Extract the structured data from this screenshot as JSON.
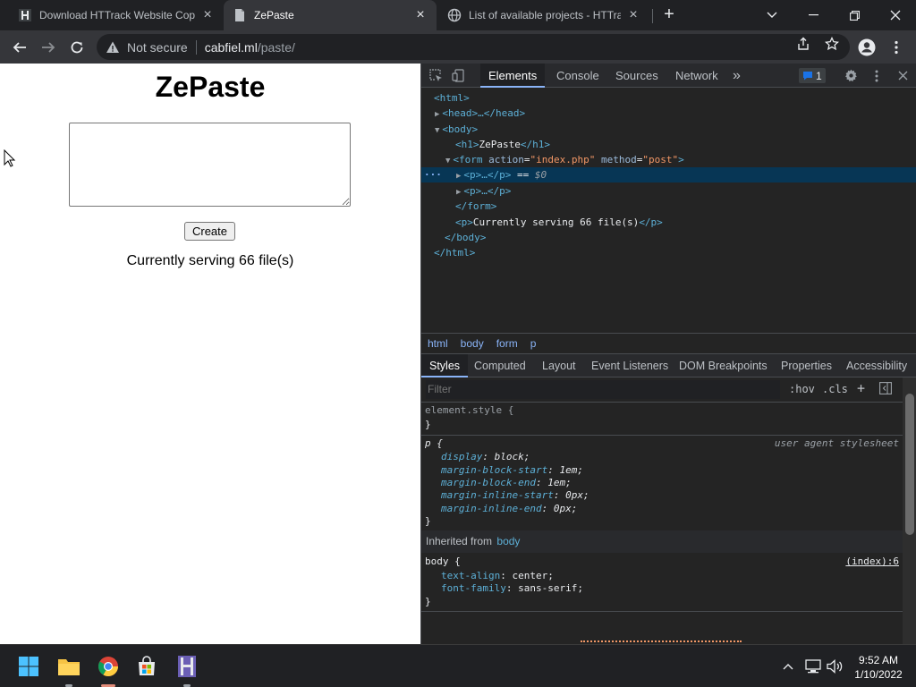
{
  "tabs": [
    {
      "title": "Download HTTrack Website Copier",
      "favicon": "httrack-icon"
    },
    {
      "title": "ZePaste",
      "favicon": "page-icon",
      "active": true
    },
    {
      "title": "List of available projects - HTTrack",
      "favicon": "globe-icon"
    }
  ],
  "omnibox": {
    "security_label": "Not secure",
    "url_host": "cabfiel.ml",
    "url_path": "/paste/"
  },
  "page": {
    "heading": "ZePaste",
    "textarea_value": "",
    "create_label": "Create",
    "serving_text": "Currently serving 66 file(s)"
  },
  "devtools": {
    "tabs": [
      "Elements",
      "Console",
      "Sources",
      "Network"
    ],
    "more": "»",
    "badge_count": "1",
    "dom": {
      "html_open": "<html>",
      "head": "<head>…</head>",
      "body_open": "<body>",
      "h1_open": "<h1>",
      "h1_text": "ZePaste",
      "h1_close": "</h1>",
      "form_tag": "<form",
      "form_action_attr": "action",
      "form_action_val": "\"index.php\"",
      "form_method_attr": "method",
      "form_method_val": "\"post\"",
      "form_gt": ">",
      "p1": "<p>…</p>",
      "p1_eq": "==",
      "p1_dollar": "$0",
      "p2": "<p>…</p>",
      "form_close": "</form>",
      "p3_open": "<p>",
      "p3_text": "Currently serving 66 file(s)",
      "p3_close": "</p>",
      "body_close": "</body>",
      "html_close": "</html>"
    },
    "breadcrumbs": [
      "html",
      "body",
      "form",
      "p"
    ],
    "subtabs": [
      "Styles",
      "Computed",
      "Layout",
      "Event Listeners",
      "DOM Breakpoints",
      "Properties",
      "Accessibility"
    ],
    "filter_placeholder": "Filter",
    "hov": ":hov",
    "cls": ".cls",
    "element_style": "element.style {",
    "close_brace": "}",
    "p_rule": {
      "selector": "p {",
      "source": "user agent stylesheet",
      "props": [
        {
          "name": "display",
          "value": "block;"
        },
        {
          "name": "margin-block-start",
          "value": "1em;"
        },
        {
          "name": "margin-block-end",
          "value": "1em;"
        },
        {
          "name": "margin-inline-start",
          "value": "0px;"
        },
        {
          "name": "margin-inline-end",
          "value": "0px;"
        }
      ]
    },
    "inherited_label": "Inherited from",
    "inherited_from": "body",
    "body_rule": {
      "selector": "body {",
      "source": "(index):6",
      "props": [
        {
          "name": "text-align",
          "value": "center;"
        },
        {
          "name": "font-family",
          "value": "sans-serif;"
        }
      ]
    }
  },
  "taskbar": {
    "time": "9:52 AM",
    "date": "1/10/2022"
  },
  "colors": {
    "accent": "#8ab4f8",
    "dom_tag": "#5db0d7",
    "dom_value": "#f29766",
    "selection": "#073655"
  }
}
